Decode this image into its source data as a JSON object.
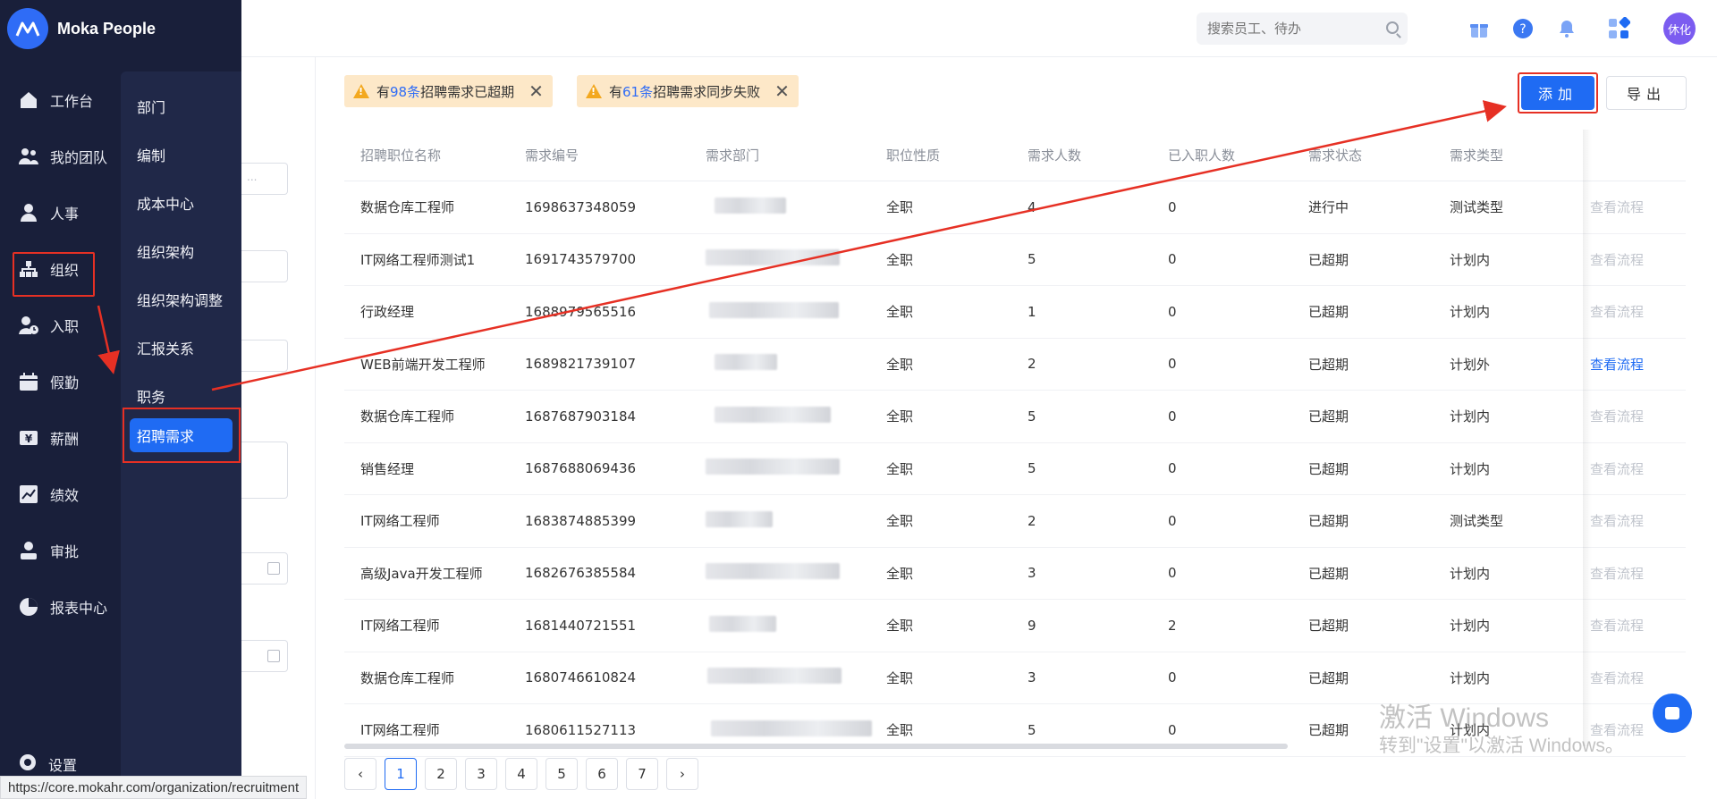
{
  "brand": {
    "name": "Moka People"
  },
  "nav": {
    "items": [
      {
        "label": "工作台",
        "icon": "home-icon"
      },
      {
        "label": "我的团队",
        "icon": "team-icon"
      },
      {
        "label": "人事",
        "icon": "person-icon"
      },
      {
        "label": "组织",
        "icon": "org-icon"
      },
      {
        "label": "入职",
        "icon": "onboard-icon"
      },
      {
        "label": "假勤",
        "icon": "calendar-icon"
      },
      {
        "label": "薪酬",
        "icon": "salary-icon"
      },
      {
        "label": "绩效",
        "icon": "performance-icon"
      },
      {
        "label": "审批",
        "icon": "approval-icon"
      },
      {
        "label": "报表中心",
        "icon": "report-icon"
      }
    ],
    "bottom": {
      "label": "设置",
      "icon": "settings-icon"
    }
  },
  "submenu": {
    "items": [
      "部门",
      "编制",
      "成本中心",
      "组织架构",
      "组织架构调整",
      "汇报关系",
      "职务",
      "招聘需求"
    ],
    "active": "招聘需求"
  },
  "header": {
    "search_placeholder": "搜索员工、待办",
    "avatar_text": "休化"
  },
  "alerts": [
    {
      "prefix": "有",
      "count": "98条",
      "suffix": "招聘需求已超期"
    },
    {
      "prefix": "有",
      "count": "61条",
      "suffix": "招聘需求同步失败"
    }
  ],
  "actions": {
    "add_label": "添加",
    "export_label": "导出"
  },
  "table": {
    "columns": [
      "招聘职位名称",
      "需求编号",
      "需求部门",
      "职位性质",
      "需求人数",
      "已入职人数",
      "需求状态",
      "需求类型"
    ],
    "action_label": "查看流程",
    "rows": [
      {
        "name": "数据仓库工程师",
        "id": "1698637348059",
        "nature": "全职",
        "count": "4",
        "hired": "0",
        "status": "进行中",
        "type": "测试类型",
        "link_active": false
      },
      {
        "name": "IT网络工程师测试1",
        "id": "1691743579700",
        "nature": "全职",
        "count": "5",
        "hired": "0",
        "status": "已超期",
        "type": "计划内",
        "link_active": false
      },
      {
        "name": "行政经理",
        "id": "1688979565516",
        "nature": "全职",
        "count": "1",
        "hired": "0",
        "status": "已超期",
        "type": "计划内",
        "link_active": false
      },
      {
        "name": "WEB前端开发工程师",
        "id": "1689821739107",
        "nature": "全职",
        "count": "2",
        "hired": "0",
        "status": "已超期",
        "type": "计划外",
        "link_active": true
      },
      {
        "name": "数据仓库工程师",
        "id": "1687687903184",
        "nature": "全职",
        "count": "5",
        "hired": "0",
        "status": "已超期",
        "type": "计划内",
        "link_active": false
      },
      {
        "name": "销售经理",
        "id": "1687688069436",
        "nature": "全职",
        "count": "5",
        "hired": "0",
        "status": "已超期",
        "type": "计划内",
        "link_active": false
      },
      {
        "name": "IT网络工程师",
        "id": "1683874885399",
        "nature": "全职",
        "count": "2",
        "hired": "0",
        "status": "已超期",
        "type": "测试类型",
        "link_active": false
      },
      {
        "name": "高级Java开发工程师",
        "id": "1682676385584",
        "nature": "全职",
        "count": "3",
        "hired": "0",
        "status": "已超期",
        "type": "计划内",
        "link_active": false
      },
      {
        "name": "IT网络工程师",
        "id": "1681440721551",
        "nature": "全职",
        "count": "9",
        "hired": "2",
        "status": "已超期",
        "type": "计划内",
        "link_active": false
      },
      {
        "name": "数据仓库工程师",
        "id": "1680746610824",
        "nature": "全职",
        "count": "3",
        "hired": "0",
        "status": "已超期",
        "type": "计划内",
        "link_active": false
      },
      {
        "name": "IT网络工程师",
        "id": "1680611527113",
        "nature": "全职",
        "count": "5",
        "hired": "0",
        "status": "已超期",
        "type": "计划内",
        "link_active": false
      }
    ]
  },
  "pagination": {
    "pages": [
      "1",
      "2",
      "3",
      "4",
      "5",
      "6",
      "7"
    ],
    "current": "1",
    "prev": "‹",
    "next": "›"
  },
  "statusbar": {
    "url": "https://core.mokahr.com/organization/recruitment"
  },
  "watermark": {
    "line1": "激活 Windows",
    "line2": "转到\"设置\"以激活 Windows。"
  },
  "colors": {
    "sidebar": "#191f3a",
    "submenu": "#202848",
    "accent": "#1f6bf3",
    "annotation": "#e63024",
    "alert_bg": "#fde8c8"
  }
}
